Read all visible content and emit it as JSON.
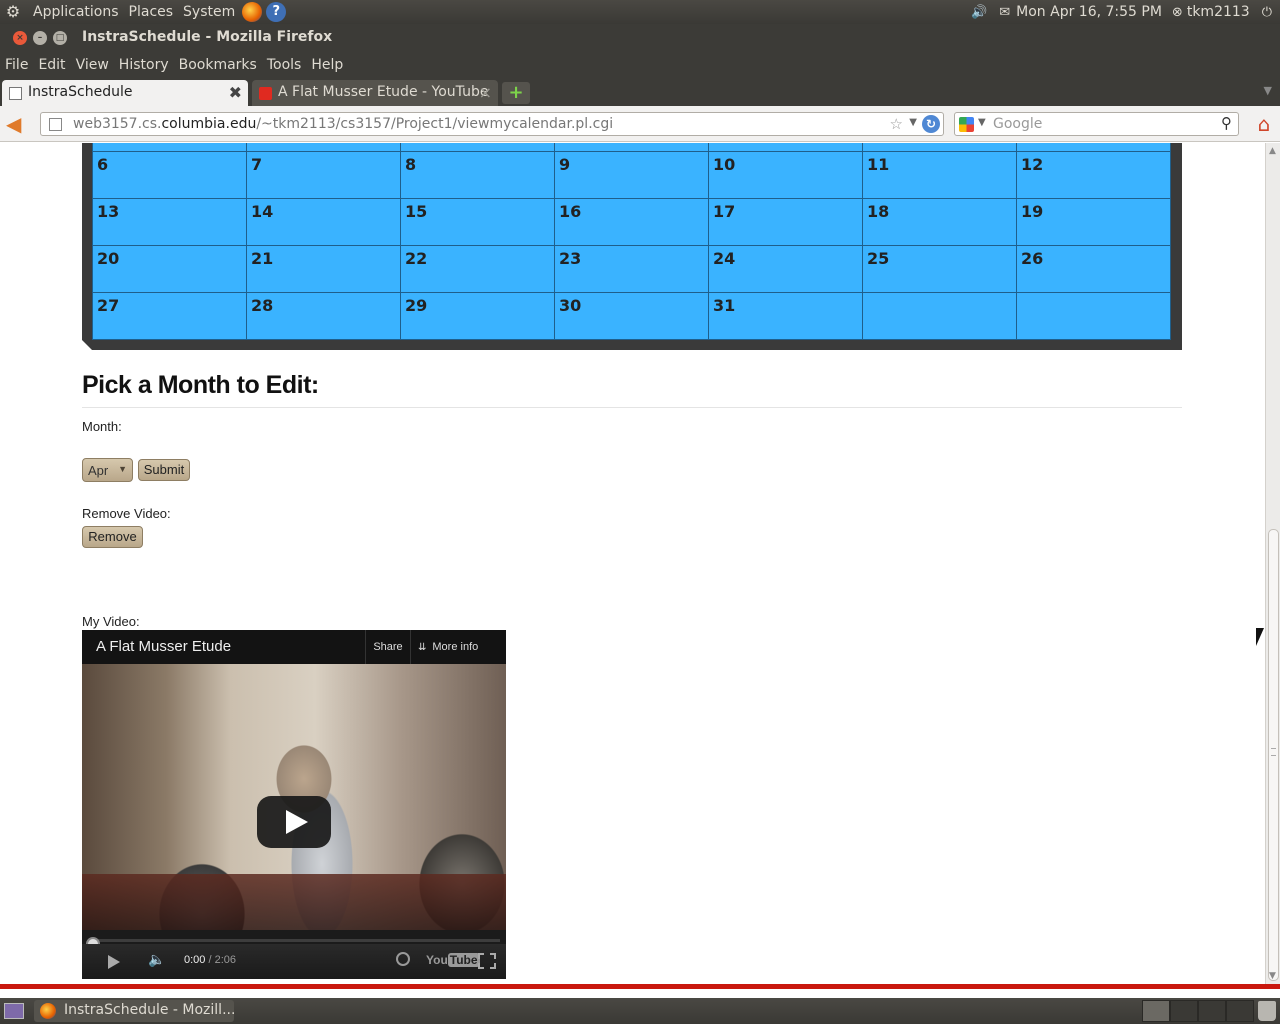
{
  "top_panel": {
    "menus": [
      "Applications",
      "Places",
      "System"
    ],
    "datetime": "Mon Apr 16,  7:55 PM",
    "user": "tkm2113"
  },
  "window": {
    "title": "InstraSchedule - Mozilla Firefox"
  },
  "menubar": [
    "File",
    "Edit",
    "View",
    "History",
    "Bookmarks",
    "Tools",
    "Help"
  ],
  "tabs": [
    {
      "label": "InstraSchedule",
      "active": true
    },
    {
      "label": "A Flat Musser Etude - YouTube",
      "active": false
    }
  ],
  "navbar": {
    "url_host": "web3157.cs.columbia.edu",
    "url_prefix": "",
    "url_path": "/~tkm2113/cs3157/Project1/viewmycalendar.pl.cgi",
    "url_host_plain": "web3157.cs.",
    "url_host_bold": "columbia.edu",
    "search_placeholder": "Google"
  },
  "calendar": {
    "cell_color": "#3ab3ff",
    "weeks": [
      [
        "",
        "",
        "",
        "",
        "",
        "",
        ""
      ],
      [
        "6",
        "7",
        "8",
        "9",
        "10",
        "11",
        "12"
      ],
      [
        "13",
        "14",
        "15",
        "16",
        "17",
        "18",
        "19"
      ],
      [
        "20",
        "21",
        "22",
        "23",
        "24",
        "25",
        "26"
      ],
      [
        "27",
        "28",
        "29",
        "30",
        "31",
        "",
        ""
      ]
    ]
  },
  "edit_form": {
    "heading": "Pick a Month to Edit:",
    "month_label": "Month:",
    "month_selected": "Apr",
    "submit_label": "Submit",
    "remove_label": "Remove Video:",
    "remove_button": "Remove",
    "video_label": "My Video:"
  },
  "video": {
    "title": "A Flat Musser Etude",
    "share_label": "Share",
    "more_info_label": "More info",
    "time_current": "0:00",
    "time_total": " / 2:06",
    "progress_fraction": 0
  },
  "taskbar": {
    "task_label": "InstraSchedule - Mozill..."
  }
}
